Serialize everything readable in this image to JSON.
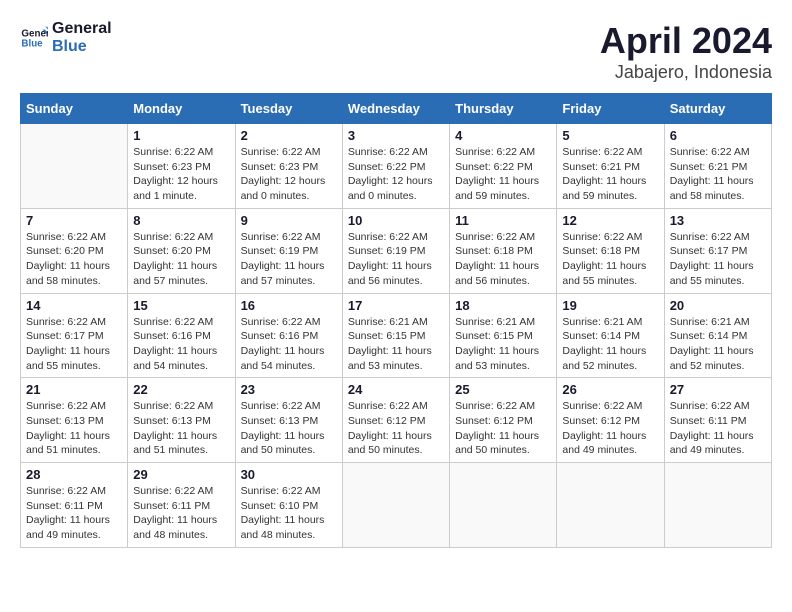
{
  "header": {
    "logo_line1": "General",
    "logo_line2": "Blue",
    "title": "April 2024",
    "subtitle": "Jabajero, Indonesia"
  },
  "days_of_week": [
    "Sunday",
    "Monday",
    "Tuesday",
    "Wednesday",
    "Thursday",
    "Friday",
    "Saturday"
  ],
  "weeks": [
    [
      {
        "day": "",
        "info": ""
      },
      {
        "day": "1",
        "info": "Sunrise: 6:22 AM\nSunset: 6:23 PM\nDaylight: 12 hours\nand 1 minute."
      },
      {
        "day": "2",
        "info": "Sunrise: 6:22 AM\nSunset: 6:23 PM\nDaylight: 12 hours\nand 0 minutes."
      },
      {
        "day": "3",
        "info": "Sunrise: 6:22 AM\nSunset: 6:22 PM\nDaylight: 12 hours\nand 0 minutes."
      },
      {
        "day": "4",
        "info": "Sunrise: 6:22 AM\nSunset: 6:22 PM\nDaylight: 11 hours\nand 59 minutes."
      },
      {
        "day": "5",
        "info": "Sunrise: 6:22 AM\nSunset: 6:21 PM\nDaylight: 11 hours\nand 59 minutes."
      },
      {
        "day": "6",
        "info": "Sunrise: 6:22 AM\nSunset: 6:21 PM\nDaylight: 11 hours\nand 58 minutes."
      }
    ],
    [
      {
        "day": "7",
        "info": "Sunrise: 6:22 AM\nSunset: 6:20 PM\nDaylight: 11 hours\nand 58 minutes."
      },
      {
        "day": "8",
        "info": "Sunrise: 6:22 AM\nSunset: 6:20 PM\nDaylight: 11 hours\nand 57 minutes."
      },
      {
        "day": "9",
        "info": "Sunrise: 6:22 AM\nSunset: 6:19 PM\nDaylight: 11 hours\nand 57 minutes."
      },
      {
        "day": "10",
        "info": "Sunrise: 6:22 AM\nSunset: 6:19 PM\nDaylight: 11 hours\nand 56 minutes."
      },
      {
        "day": "11",
        "info": "Sunrise: 6:22 AM\nSunset: 6:18 PM\nDaylight: 11 hours\nand 56 minutes."
      },
      {
        "day": "12",
        "info": "Sunrise: 6:22 AM\nSunset: 6:18 PM\nDaylight: 11 hours\nand 55 minutes."
      },
      {
        "day": "13",
        "info": "Sunrise: 6:22 AM\nSunset: 6:17 PM\nDaylight: 11 hours\nand 55 minutes."
      }
    ],
    [
      {
        "day": "14",
        "info": "Sunrise: 6:22 AM\nSunset: 6:17 PM\nDaylight: 11 hours\nand 55 minutes."
      },
      {
        "day": "15",
        "info": "Sunrise: 6:22 AM\nSunset: 6:16 PM\nDaylight: 11 hours\nand 54 minutes."
      },
      {
        "day": "16",
        "info": "Sunrise: 6:22 AM\nSunset: 6:16 PM\nDaylight: 11 hours\nand 54 minutes."
      },
      {
        "day": "17",
        "info": "Sunrise: 6:21 AM\nSunset: 6:15 PM\nDaylight: 11 hours\nand 53 minutes."
      },
      {
        "day": "18",
        "info": "Sunrise: 6:21 AM\nSunset: 6:15 PM\nDaylight: 11 hours\nand 53 minutes."
      },
      {
        "day": "19",
        "info": "Sunrise: 6:21 AM\nSunset: 6:14 PM\nDaylight: 11 hours\nand 52 minutes."
      },
      {
        "day": "20",
        "info": "Sunrise: 6:21 AM\nSunset: 6:14 PM\nDaylight: 11 hours\nand 52 minutes."
      }
    ],
    [
      {
        "day": "21",
        "info": "Sunrise: 6:22 AM\nSunset: 6:13 PM\nDaylight: 11 hours\nand 51 minutes."
      },
      {
        "day": "22",
        "info": "Sunrise: 6:22 AM\nSunset: 6:13 PM\nDaylight: 11 hours\nand 51 minutes."
      },
      {
        "day": "23",
        "info": "Sunrise: 6:22 AM\nSunset: 6:13 PM\nDaylight: 11 hours\nand 50 minutes."
      },
      {
        "day": "24",
        "info": "Sunrise: 6:22 AM\nSunset: 6:12 PM\nDaylight: 11 hours\nand 50 minutes."
      },
      {
        "day": "25",
        "info": "Sunrise: 6:22 AM\nSunset: 6:12 PM\nDaylight: 11 hours\nand 50 minutes."
      },
      {
        "day": "26",
        "info": "Sunrise: 6:22 AM\nSunset: 6:12 PM\nDaylight: 11 hours\nand 49 minutes."
      },
      {
        "day": "27",
        "info": "Sunrise: 6:22 AM\nSunset: 6:11 PM\nDaylight: 11 hours\nand 49 minutes."
      }
    ],
    [
      {
        "day": "28",
        "info": "Sunrise: 6:22 AM\nSunset: 6:11 PM\nDaylight: 11 hours\nand 49 minutes."
      },
      {
        "day": "29",
        "info": "Sunrise: 6:22 AM\nSunset: 6:11 PM\nDaylight: 11 hours\nand 48 minutes."
      },
      {
        "day": "30",
        "info": "Sunrise: 6:22 AM\nSunset: 6:10 PM\nDaylight: 11 hours\nand 48 minutes."
      },
      {
        "day": "",
        "info": ""
      },
      {
        "day": "",
        "info": ""
      },
      {
        "day": "",
        "info": ""
      },
      {
        "day": "",
        "info": ""
      }
    ]
  ]
}
